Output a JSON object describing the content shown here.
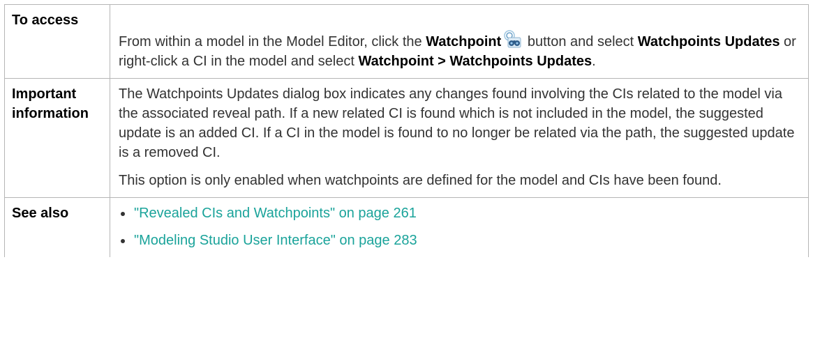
{
  "rows": {
    "access": {
      "label": "To access",
      "segments": [
        "From within a model in the Model Editor, click the ",
        "Watchpoint",
        " button and select ",
        "Watchpoints Updates",
        " or right-click a CI in the model and select ",
        "Watchpoint > Watchpoints Updates",
        "."
      ],
      "icon": "watchpoint-binoculars-icon"
    },
    "important": {
      "label": "Important information",
      "paragraph1": "The Watchpoints Updates dialog box indicates any changes found involving the CIs related to the model via the associated reveal path. If a new related CI is found which is not included in the model, the suggested update is an added CI. If a CI in the model is found to no longer be related via the path, the suggested update is a removed CI.",
      "paragraph2": "This option is only enabled when watchpoints are defined for the model and CIs have been found."
    },
    "see_also": {
      "label": "See also",
      "links": [
        "\"Revealed CIs and Watchpoints\" on page 261",
        "\"Modeling Studio User Interface\" on page 283"
      ]
    }
  },
  "colors": {
    "link": "#1aa39a",
    "border": "#b5b5b5",
    "text": "#333333"
  }
}
